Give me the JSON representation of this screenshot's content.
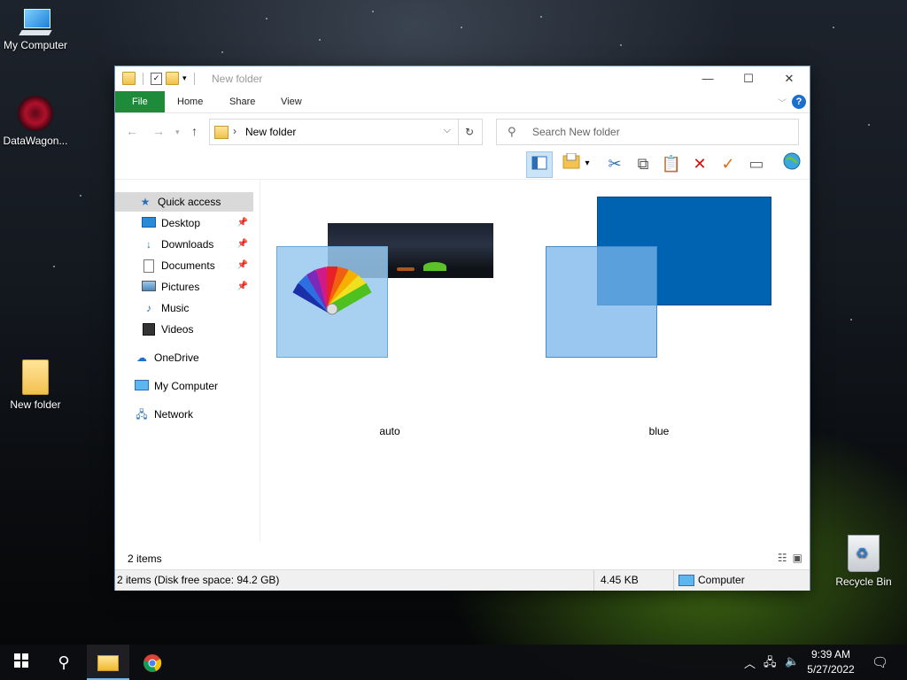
{
  "desktop": {
    "icons": [
      {
        "label": "My Computer"
      },
      {
        "label": "DataWagon..."
      },
      {
        "label": "New folder"
      },
      {
        "label": "Recycle Bin"
      }
    ]
  },
  "window": {
    "title": "New folder",
    "controls": {
      "minimize": "—",
      "maximize": "☐",
      "close": "✕"
    },
    "tabs": {
      "file": "File",
      "home": "Home",
      "share": "Share",
      "view": "View"
    },
    "address": {
      "path": "New folder"
    },
    "search": {
      "placeholder": "Search New folder"
    },
    "nav": {
      "quick_access": "Quick access",
      "items": [
        {
          "label": "Desktop",
          "pinned": true
        },
        {
          "label": "Downloads",
          "pinned": true
        },
        {
          "label": "Documents",
          "pinned": true
        },
        {
          "label": "Pictures",
          "pinned": true
        },
        {
          "label": "Music",
          "pinned": false
        },
        {
          "label": "Videos",
          "pinned": false
        }
      ],
      "onedrive": "OneDrive",
      "my_computer": "My Computer",
      "network": "Network"
    },
    "files": [
      {
        "name": "auto"
      },
      {
        "name": "blue"
      }
    ],
    "status": {
      "count": "2 items"
    },
    "infobar": {
      "summary": "2 items (Disk free space: 94.2 GB)",
      "size": "4.45 KB",
      "location": "Computer"
    }
  },
  "taskbar": {
    "time": "9:39 AM",
    "date": "5/27/2022"
  },
  "colors": {
    "file_tab": "#1d8b39",
    "selection": "#cce4f7",
    "blue_tile": "#0063b1",
    "taskbar_accent": "#76b9ed"
  }
}
